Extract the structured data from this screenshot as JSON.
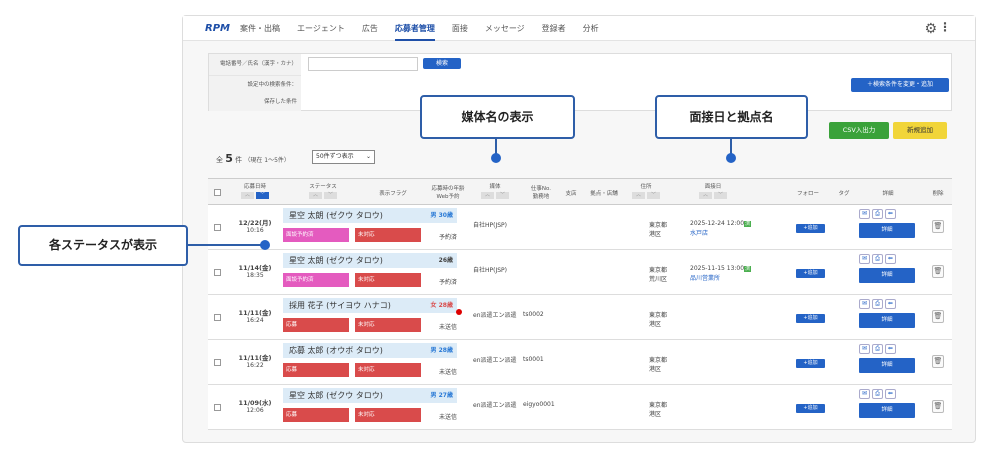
{
  "nav": {
    "logo": "RPM",
    "items": [
      "案件・出稿",
      "エージェント",
      "広告",
      "応募者管理",
      "面接",
      "メッセージ",
      "登録者",
      "分析"
    ],
    "active": 3
  },
  "search": {
    "phone_label": "電話番号／氏名（漢字・カナ）",
    "phone_value": "",
    "search_button": "検索",
    "current_conditions_label": "設定中の検索条件：",
    "saved_conditions_label": "保存した条件",
    "change_conditions_button": "＋検索条件を変更・追加"
  },
  "actions": {
    "csv": "CSV入出力",
    "new": "新規追加"
  },
  "summary": {
    "prefix": "全",
    "count": "5",
    "unit": "件",
    "range": "（現在 1～5件）",
    "per_page": "50件ずつ表示"
  },
  "columns": {
    "date": "応募日時",
    "status": "ステータス",
    "flag": "表示フラグ",
    "age": "応募時の年齢",
    "web": "Web予約",
    "media": "媒体",
    "jobno1": "仕事No.",
    "jobno2": "勤務地",
    "branch": "支店",
    "base": "拠点・店舗",
    "address": "住所",
    "interview": "面接日",
    "follow": "フォロー",
    "tag": "タグ",
    "detail": "詳細",
    "delete": "削除"
  },
  "rows": [
    {
      "date": "12/22(月)",
      "time": "10:16",
      "name": "星空 太朗 (ゼクウ タロウ)",
      "age": "男 30歳",
      "gender": "m",
      "status": "面談予約済",
      "status_color": "pink",
      "flag": "未対応",
      "web": "予約済",
      "media": "自社HP(JSP)",
      "jobno": "",
      "pref": "東京都",
      "city": "港区",
      "interview": "2025-12-24 12:00",
      "interview_badge": "済",
      "base": "水戸店",
      "red": false
    },
    {
      "date": "11/14(金)",
      "time": "18:35",
      "name": "星空 太朗 (ゼクウ タロウ)",
      "age": "26歳",
      "gender": "",
      "status": "面談予約済",
      "status_color": "pink",
      "flag": "未対応",
      "web": "予約済",
      "media": "自社HP(JSP)",
      "jobno": "",
      "pref": "東京都",
      "city": "荒川区",
      "interview": "2025-11-15 13:00",
      "interview_badge": "済",
      "base": "品川営業所",
      "red": false
    },
    {
      "date": "11/11(金)",
      "time": "16:24",
      "name": "採用 花子 (サイヨウ ハナコ)",
      "age": "女 28歳",
      "gender": "f",
      "status": "応募",
      "status_color": "red",
      "flag": "未対応",
      "web": "未送信",
      "media": "en派遣エン派遣",
      "jobno": "ts0002",
      "pref": "東京都",
      "city": "港区",
      "interview": "",
      "interview_badge": "",
      "base": "",
      "red": true
    },
    {
      "date": "11/11(金)",
      "time": "16:22",
      "name": "応募 太郎 (オウボ タロウ)",
      "age": "男 28歳",
      "gender": "m",
      "status": "応募",
      "status_color": "red",
      "flag": "未対応",
      "web": "未送信",
      "media": "en派遣エン派遣",
      "jobno": "ts0001",
      "pref": "東京都",
      "city": "港区",
      "interview": "",
      "interview_badge": "",
      "base": "",
      "red": false
    },
    {
      "date": "11/09(水)",
      "time": "12:06",
      "name": "星空 太郎 (ゼクウ タロウ)",
      "age": "男 27歳",
      "gender": "m",
      "status": "応募",
      "status_color": "red",
      "flag": "未対応",
      "web": "未送信",
      "media": "en派遣エン派遣",
      "jobno": "eigyo0001",
      "pref": "東京都",
      "city": "港区",
      "interview": "",
      "interview_badge": "",
      "base": "",
      "red": false
    }
  ],
  "row_buttons": {
    "follow_add": "+追加",
    "detail": "詳細"
  },
  "callouts": {
    "media": "媒体名の表示",
    "interview": "面接日と拠点名",
    "status": "各ステータスが表示"
  }
}
